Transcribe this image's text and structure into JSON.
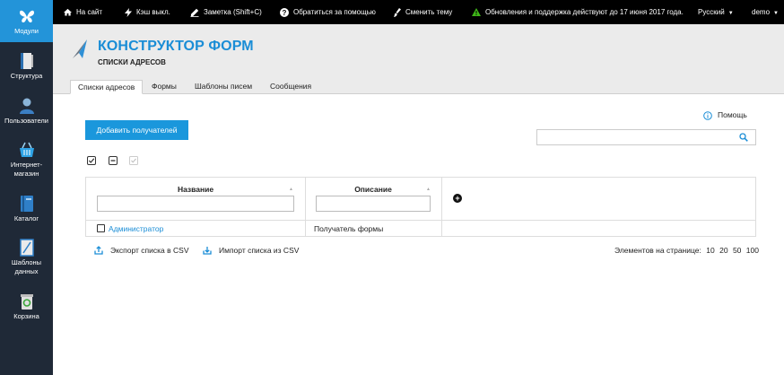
{
  "sidebar": {
    "items": [
      {
        "label": "Модули",
        "icon": "butterfly-icon",
        "active": true
      },
      {
        "label": "Структура",
        "icon": "structure-icon"
      },
      {
        "label": "Пользователи",
        "icon": "user-icon"
      },
      {
        "label": "Интернет-магазин",
        "icon": "basket-icon"
      },
      {
        "label": "Каталог",
        "icon": "book-icon"
      },
      {
        "label": "Шаблоны данных",
        "icon": "data-template-icon"
      },
      {
        "label": "Корзина",
        "icon": "trash-icon"
      }
    ]
  },
  "topbar": {
    "home": "На сайт",
    "cache": "Кэш выкл.",
    "note": "Заметка (Shift+C)",
    "support": "Обратиться за помощью",
    "theme": "Сменить тему",
    "updates": "Обновления и поддержка действуют до 17 июня 2017 года.",
    "language": "Русский",
    "user": "demo"
  },
  "header": {
    "title": "КОНСТРУКТОР ФОРМ",
    "subtitle": "СПИСКИ АДРЕСОВ"
  },
  "tabs": [
    "Списки адресов",
    "Формы",
    "Шаблоны писем",
    "Сообщения"
  ],
  "main": {
    "help": "Помощь",
    "add_button": "Добавить получателей",
    "search_placeholder": "",
    "table": {
      "columns": [
        "Название",
        "Описание"
      ],
      "rows": [
        {
          "name": "Администратор",
          "description": "Получатель формы"
        }
      ]
    },
    "export_csv": "Экспорт списка в CSV",
    "import_csv": "Импорт списка из CSV",
    "per_page_label": "Элементов на странице:",
    "per_page_options": [
      "10",
      "20",
      "50",
      "100"
    ]
  },
  "colors": {
    "accent": "#1a97dc",
    "sidebar_bg": "#1f2937",
    "topbar_bg": "#000000",
    "header_bg": "#ebebeb",
    "warning": "#3fb618"
  }
}
